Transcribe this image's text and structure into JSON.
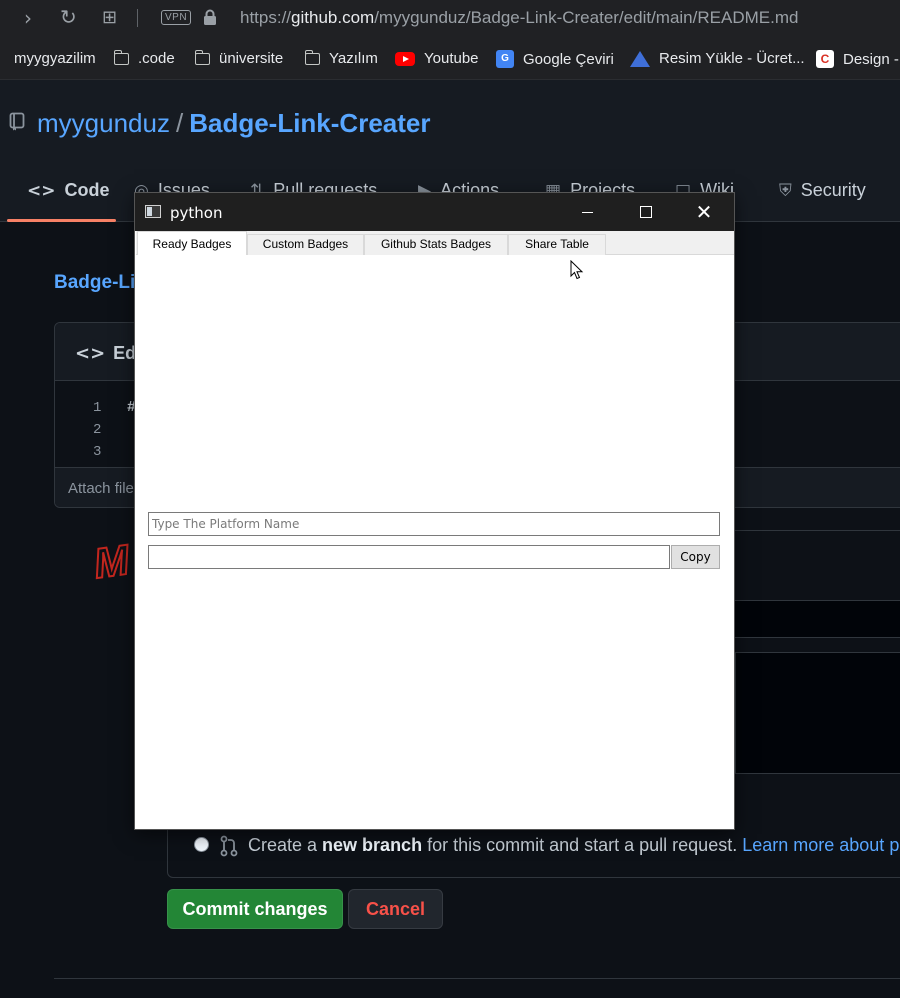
{
  "browser": {
    "vpn_label": "VPN",
    "url_prefix": "https://",
    "url_host": "github.com",
    "url_path": "/myygunduz/Badge-Link-Creater/edit/main/README.md",
    "bookmarks": [
      {
        "label": "myygyazilim",
        "icon": "none"
      },
      {
        "label": ".code",
        "icon": "folder-icon"
      },
      {
        "label": "üniversite",
        "icon": "folder-icon"
      },
      {
        "label": "Yazılım",
        "icon": "folder-icon"
      },
      {
        "label": "Youtube",
        "icon": "youtube-icon"
      },
      {
        "label": "Google Çeviri",
        "icon": "google-translate-icon"
      },
      {
        "label": "Resim Yükle - Ücret...",
        "icon": "upload-triangle-icon"
      },
      {
        "label": "Design -",
        "icon": "design-icon"
      }
    ]
  },
  "github": {
    "owner": "myygunduz",
    "slash": "/",
    "repo": "Badge-Link-Creater",
    "tabs": [
      "Code",
      "Issues",
      "Pull requests",
      "Actions",
      "Projects",
      "Wiki",
      "Security"
    ],
    "breadcrumb_partial": "Badge-Li",
    "edit_tab_partial": "Edit",
    "line_numbers": [
      "1",
      "2",
      "3"
    ],
    "line1_partial": "#",
    "attach_partial": "Attach file",
    "branch_option": {
      "prefix": "Create a ",
      "bold": "new branch",
      "middle": " for this commit and start a pull request. ",
      "link": "Learn more about pull"
    },
    "commit_button": "Commit changes",
    "cancel_button": "Cancel",
    "accent": "#58a6ff",
    "commit_color": "#238636"
  },
  "python_window": {
    "title": "python",
    "tabs": [
      "Ready Badges",
      "Custom Badges",
      "Github Stats Badges",
      "Share Table"
    ],
    "active_tab": "Ready Badges",
    "platform_placeholder": "Type The Platform Name",
    "platform_value": "",
    "result_value": "",
    "copy_button": "Copy"
  }
}
